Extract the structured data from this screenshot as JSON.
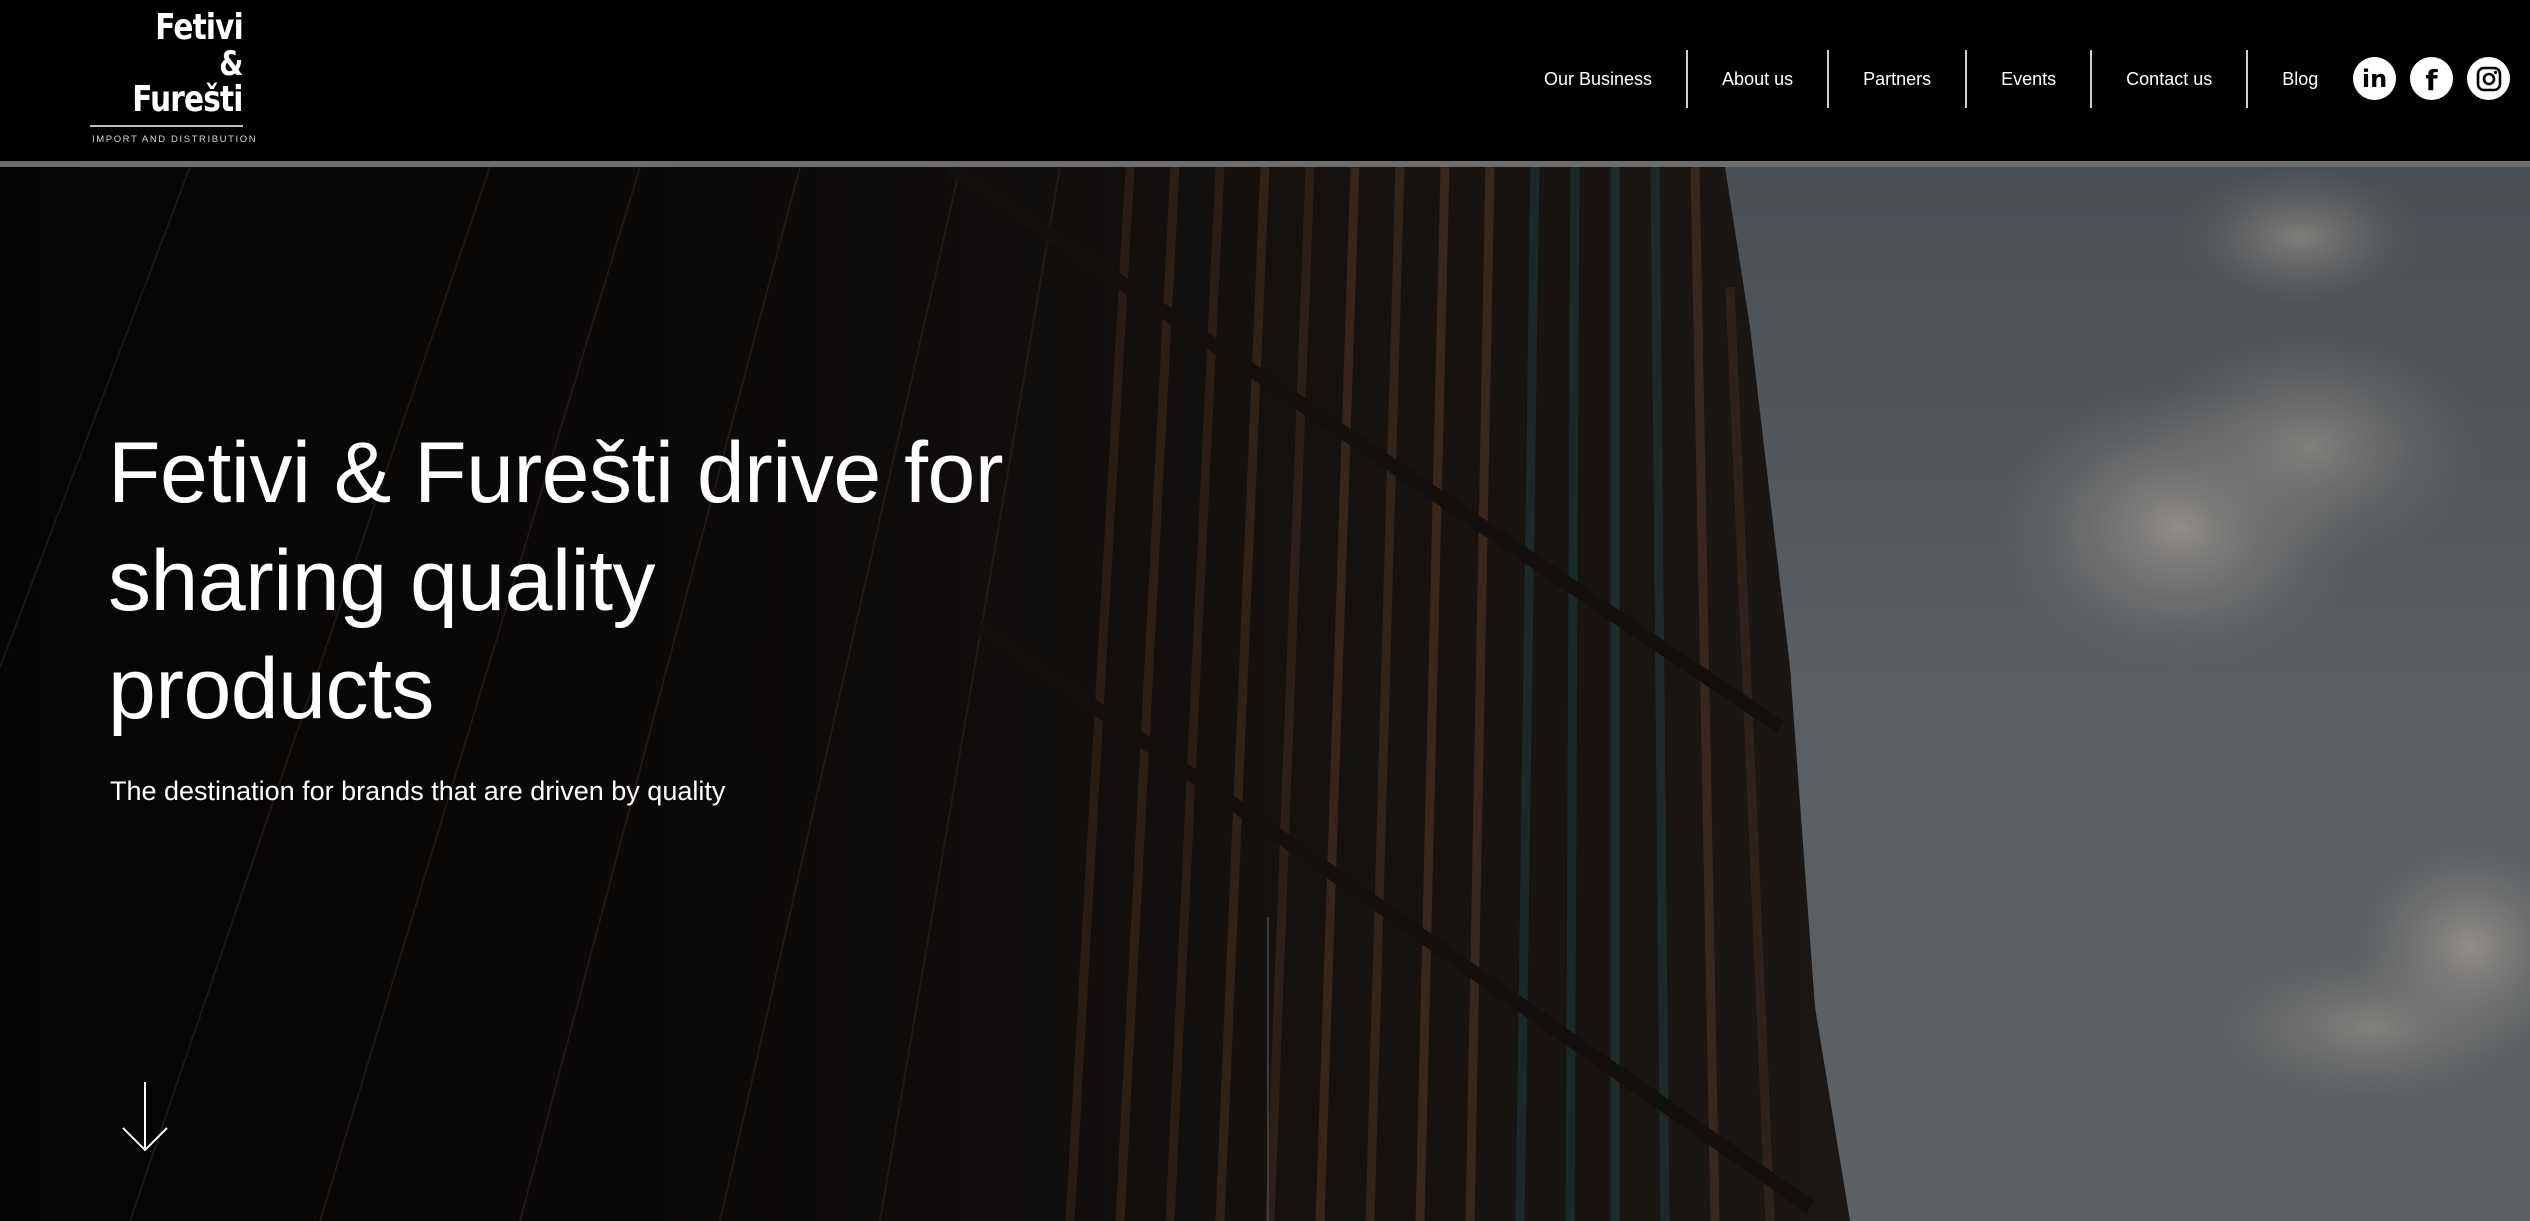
{
  "brand": {
    "logo_line1": "Fetivi",
    "logo_line2": "&",
    "logo_line3": "Furešti",
    "tagline": "IMPORT AND DISTRIBUTION"
  },
  "nav": {
    "items": [
      "Our Business",
      "About us",
      "Partners",
      "Events",
      "Contact us",
      "Blog"
    ]
  },
  "social": {
    "linkedin_label": "in",
    "facebook_label": "f"
  },
  "hero": {
    "title_line1": "Fetivi & Furešti drive for",
    "title_line2": "sharing quality",
    "title_line3": "products",
    "subtitle": "The destination for brands that are driven by quality"
  },
  "colors": {
    "background": "#000000",
    "text": "#ffffff",
    "header_rule": "#6d6d6d",
    "sky": "#565c61"
  },
  "icons": {
    "scroll": "arrow-down-icon",
    "linkedin": "linkedin-icon",
    "facebook": "facebook-icon",
    "instagram": "instagram-icon"
  }
}
